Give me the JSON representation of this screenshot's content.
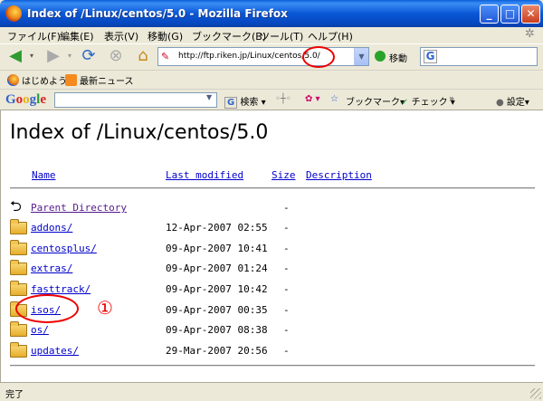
{
  "window": {
    "title": "Index of /Linux/centos/5.0 - Mozilla Firefox"
  },
  "menu": [
    "ファイル(F)",
    "編集(E)",
    "表示(V)",
    "移動(G)",
    "ブックマーク(B)",
    "ツール(T)",
    "ヘルプ(H)"
  ],
  "nav": {
    "url": "http://ftp.riken.jp/Linux/centos/5.0/",
    "go_label": "移動"
  },
  "bookmarks": [
    "はじめよう",
    "最新ニュース"
  ],
  "google_toolbar": {
    "logo": "Google",
    "search_label": "検索",
    "bookmark_label": "ブックマーク",
    "check_label": "チェック",
    "settings_label": "設定"
  },
  "page": {
    "title": "Index of /Linux/centos/5.0",
    "columns": {
      "name": "Name",
      "modified": "Last modified",
      "size": "Size",
      "description": "Description"
    },
    "parent": {
      "name": "Parent Directory",
      "size": "-"
    },
    "rows": [
      {
        "name": "addons/",
        "modified": "12-Apr-2007 02:55",
        "size": "-"
      },
      {
        "name": "centosplus/",
        "modified": "09-Apr-2007 10:41",
        "size": "-"
      },
      {
        "name": "extras/",
        "modified": "09-Apr-2007 01:24",
        "size": "-"
      },
      {
        "name": "fasttrack/",
        "modified": "09-Apr-2007 10:42",
        "size": "-"
      },
      {
        "name": "isos/",
        "modified": "09-Apr-2007 00:35",
        "size": "-"
      },
      {
        "name": "os/",
        "modified": "09-Apr-2007 08:38",
        "size": "-"
      },
      {
        "name": "updates/",
        "modified": "29-Mar-2007 20:56",
        "size": "-"
      }
    ],
    "annotation_number": "①"
  },
  "status": {
    "text": "完了"
  },
  "colors": {
    "link": "#0000cc",
    "visited": "#551a8b",
    "annotation": "#ee0000",
    "titlebar": "#0a57d5"
  }
}
